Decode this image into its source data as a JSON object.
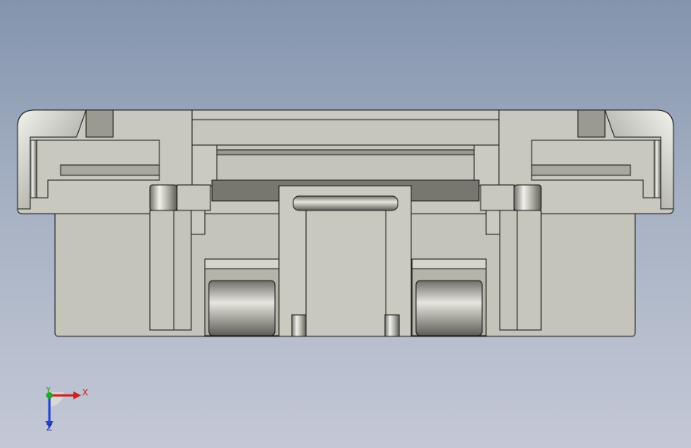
{
  "viewport": {
    "background_top": "#8394ad",
    "background_bottom": "#c4c8d6"
  },
  "model": {
    "name": "",
    "face_color": "#c8c8be",
    "shadow_color": "#7a7a72",
    "edge_color": "#1a1a1a"
  },
  "triad": {
    "x_label": "X",
    "y_label": "Y",
    "z_label": "Z",
    "x_color": "#cc2222",
    "y_color": "#22aa22",
    "z_color": "#2244cc"
  }
}
